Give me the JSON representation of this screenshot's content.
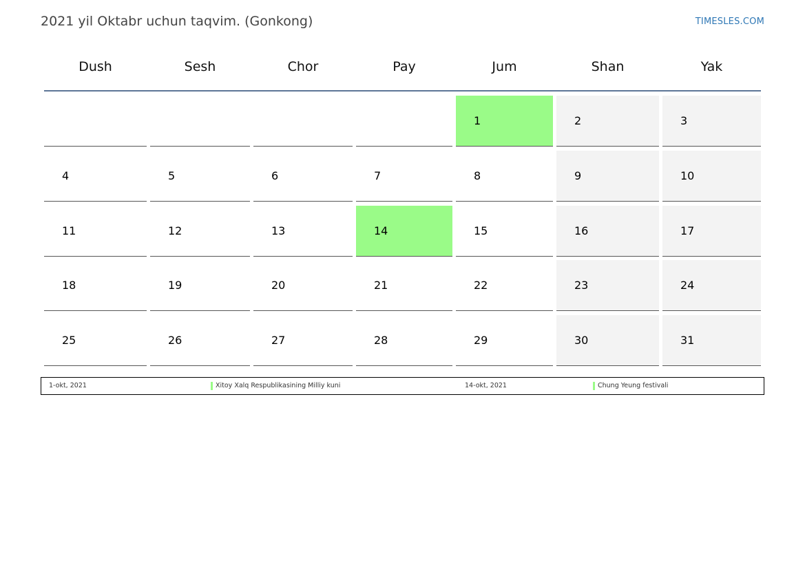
{
  "header": {
    "title": "2021 yil Oktabr uchun taqvim. (Gonkong)",
    "site": "TIMESLES.COM"
  },
  "weekdays": [
    "Dush",
    "Sesh",
    "Chor",
    "Pay",
    "Jum",
    "Shan",
    "Yak"
  ],
  "colors": {
    "holiday": "#9afb88",
    "weekend": "#f3f3f3",
    "header_rule": "#5c7596",
    "site_link": "#2e77b5"
  },
  "weeks": [
    [
      "",
      "",
      "",
      "",
      "1",
      "2",
      "3"
    ],
    [
      "4",
      "5",
      "6",
      "7",
      "8",
      "9",
      "10"
    ],
    [
      "11",
      "12",
      "13",
      "14",
      "15",
      "16",
      "17"
    ],
    [
      "18",
      "19",
      "20",
      "21",
      "22",
      "23",
      "24"
    ],
    [
      "25",
      "26",
      "27",
      "28",
      "29",
      "30",
      "31"
    ]
  ],
  "holidays": [
    {
      "date": "1-okt, 2021",
      "name": "Xitoy Xalq Respublikasining Milliy kuni"
    },
    {
      "date": "14-okt, 2021",
      "name": "Chung Yeung festivali"
    }
  ]
}
